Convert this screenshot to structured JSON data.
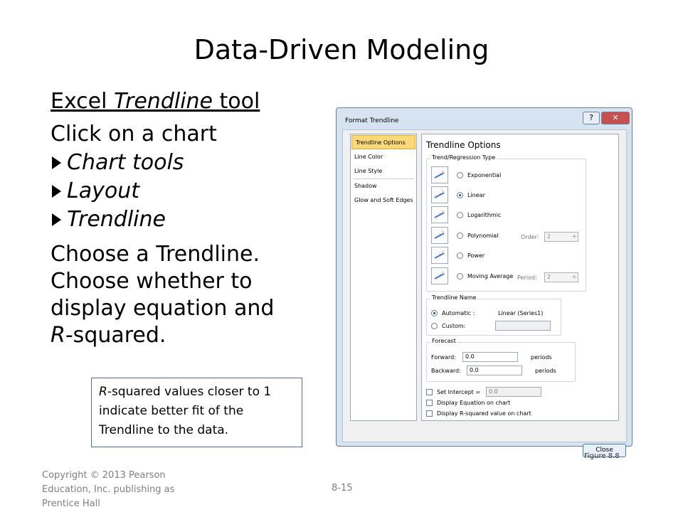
{
  "slide": {
    "title": "Data-Driven Modeling",
    "heading_pre": "Excel ",
    "heading_italic": "Trendline",
    "heading_post": " tool",
    "intro": "Click on a chart",
    "steps": [
      "Chart tools",
      "Layout",
      "Trendline"
    ],
    "para_l1": "Choose a Trendline.",
    "para_l2": "Choose whether to",
    "para_l3": "display equation and",
    "para_l4_italic": "R",
    "para_l4_rest": "-squared.",
    "note_italic": "R",
    "note_rest": "-squared values closer to 1 indicate better fit of the Trendline to the data.",
    "figure_caption": "Figure 8.8",
    "footer_copyright": "Copyright © 2013 Pearson Education, Inc. publishing as Prentice Hall",
    "page_number": "8-15"
  },
  "dialog": {
    "title": "Format Trendline",
    "help_label": "?",
    "close_x": "✕",
    "nav_items": [
      "Trendline Options",
      "Line Color",
      "Line Style",
      "Shadow",
      "Glow and Soft Edges"
    ],
    "panel_title": "Trendline Options",
    "type_group": "Trend/Regression Type",
    "types": [
      "Exponential",
      "Linear",
      "Logarithmic",
      "Polynomial",
      "Power",
      "Moving Average"
    ],
    "selected_type": "Linear",
    "order_label": "Order:",
    "order_value": "2",
    "period_label": "Period:",
    "period_value": "2",
    "name_group": "Trendline Name",
    "automatic_label": "Automatic :",
    "automatic_value": "Linear (Series1)",
    "custom_label": "Custom:",
    "forecast_group": "Forecast",
    "forward_label": "Forward:",
    "forward_value": "0.0",
    "backward_label": "Backward:",
    "backward_value": "0.0",
    "periods_label": "periods",
    "intercept_label": "Set Intercept =",
    "intercept_value": "0.0",
    "display_equation_label": "Display Equation on chart",
    "display_r2_label": "Display R-squared value on chart",
    "close_label": "Close"
  }
}
